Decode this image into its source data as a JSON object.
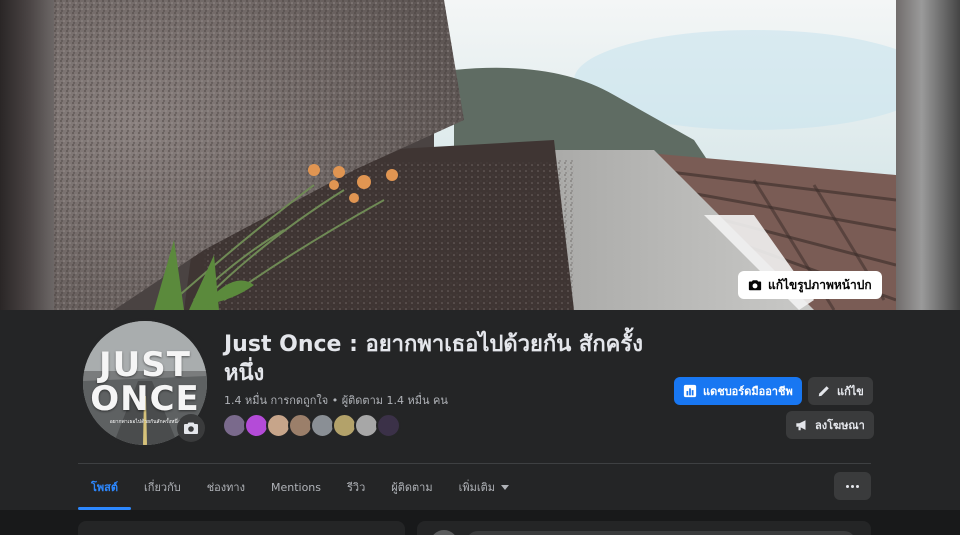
{
  "cover": {
    "edit_label": "แก้ไขรูปภาพหน้าปก"
  },
  "page": {
    "title": "Just Once : อยากพาเธอไปด้วยกัน สักครั้งหนึ่ง",
    "likes": "1.4 หมื่น การกดถูกใจ",
    "separator": "•",
    "followers": "ผู้ติดตาม 1.4 หมื่น คน",
    "avatar_logo_line1": "JUST",
    "avatar_logo_line2": "ONCE",
    "avatar_subtitle": "อยากพาเธอไปด้วยกันสักครั้งหนึ่ง"
  },
  "actions": {
    "dashboard_label": "แดชบอร์ดมืออาชีพ",
    "edit_label": "แก้ไข",
    "ads_label": "ลงโฆษณา"
  },
  "tabs": [
    {
      "label": "โพสต์",
      "active": true
    },
    {
      "label": "เกี่ยวกับ",
      "active": false
    },
    {
      "label": "ช่องทาง",
      "active": false
    },
    {
      "label": "Mentions",
      "active": false
    },
    {
      "label": "รีวิว",
      "active": false
    },
    {
      "label": "ผู้ติดตาม",
      "active": false
    },
    {
      "label": "เพิ่มเติม",
      "active": false
    }
  ],
  "friend_avatars": [
    {
      "color": "#7a6a8c"
    },
    {
      "color": "#b44bd8"
    },
    {
      "color": "#c7a58a"
    },
    {
      "color": "#9b7f6a"
    },
    {
      "color": "#8a8f95"
    },
    {
      "color": "#b3a26a"
    },
    {
      "color": "#a7a7a7"
    },
    {
      "color": "#3b3148"
    }
  ],
  "colors": {
    "accent": "#2d88ff",
    "primary_button": "#1877f2",
    "surface": "#242526",
    "background": "#18191a"
  },
  "icons": {
    "camera": "camera-icon",
    "dashboard": "bar-chart-icon",
    "edit": "pencil-icon",
    "ads": "megaphone-icon",
    "more": "ellipsis-icon"
  }
}
